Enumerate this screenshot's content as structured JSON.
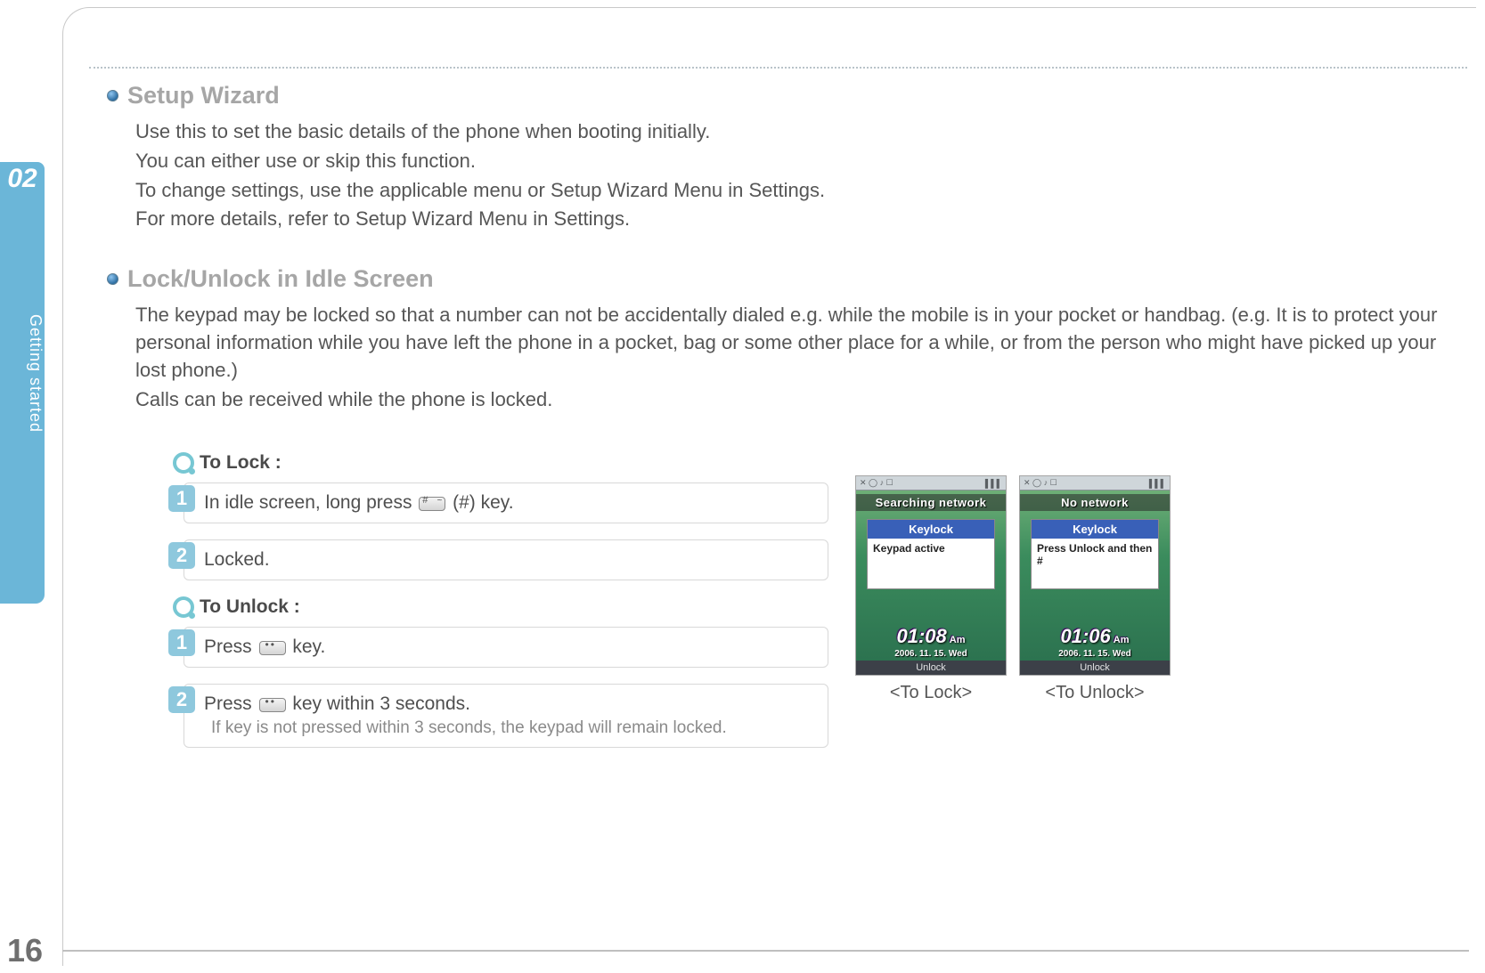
{
  "chapter_number": "02",
  "sidebar_label": "Getting started",
  "page_number": "16",
  "sections": {
    "setup_wizard": {
      "title": "Setup Wizard",
      "lines": [
        "Use this to set the basic details of the phone when booting initially.",
        "You can either use or skip this function.",
        "To change settings, use the applicable menu or Setup Wizard Menu in Settings.",
        "For more details, refer to Setup Wizard Menu in Settings."
      ]
    },
    "lock_unlock": {
      "title": "Lock/Unlock in Idle Screen",
      "body": "The keypad may be locked so that a number can not be accidentally dialed e.g. while the mobile is in your pocket or handbag. (e.g. It is to protect your personal information while you have left the phone in a pocket, bag or some other place for a while, or from the person who might have picked up your lost phone.)",
      "body2": "Calls can be received while the phone is locked.",
      "to_lock_heading": "To Lock :",
      "to_lock_steps": [
        {
          "num": "1",
          "pre": "In idle screen, long press ",
          "key": "hash",
          "post": " (#) key."
        },
        {
          "num": "2",
          "pre": "Locked.",
          "key": "",
          "post": ""
        }
      ],
      "to_unlock_heading": "To Unlock :",
      "to_unlock_steps": [
        {
          "num": "1",
          "pre": "Press ",
          "key": "dots",
          "post": " key."
        },
        {
          "num": "2",
          "pre": "Press ",
          "key": "dots",
          "post": " key within 3 seconds.",
          "note": "If key is not pressed within 3 seconds, the keypad will remain locked."
        }
      ]
    }
  },
  "screens": {
    "lock": {
      "banner": "Searching network",
      "popup_title": "Keylock",
      "popup_body": "Keypad active",
      "time": "01:08",
      "ampm": "Am",
      "date": "2006. 11. 15. Wed",
      "softkey": "Unlock",
      "caption": "<To Lock>"
    },
    "unlock": {
      "banner": "No network",
      "popup_title": "Keylock",
      "popup_body": "Press Unlock and then #",
      "time": "01:06",
      "ampm": "Am",
      "date": "2006. 11. 15. Wed",
      "softkey": "Unlock",
      "caption": "<To Unlock>"
    }
  }
}
